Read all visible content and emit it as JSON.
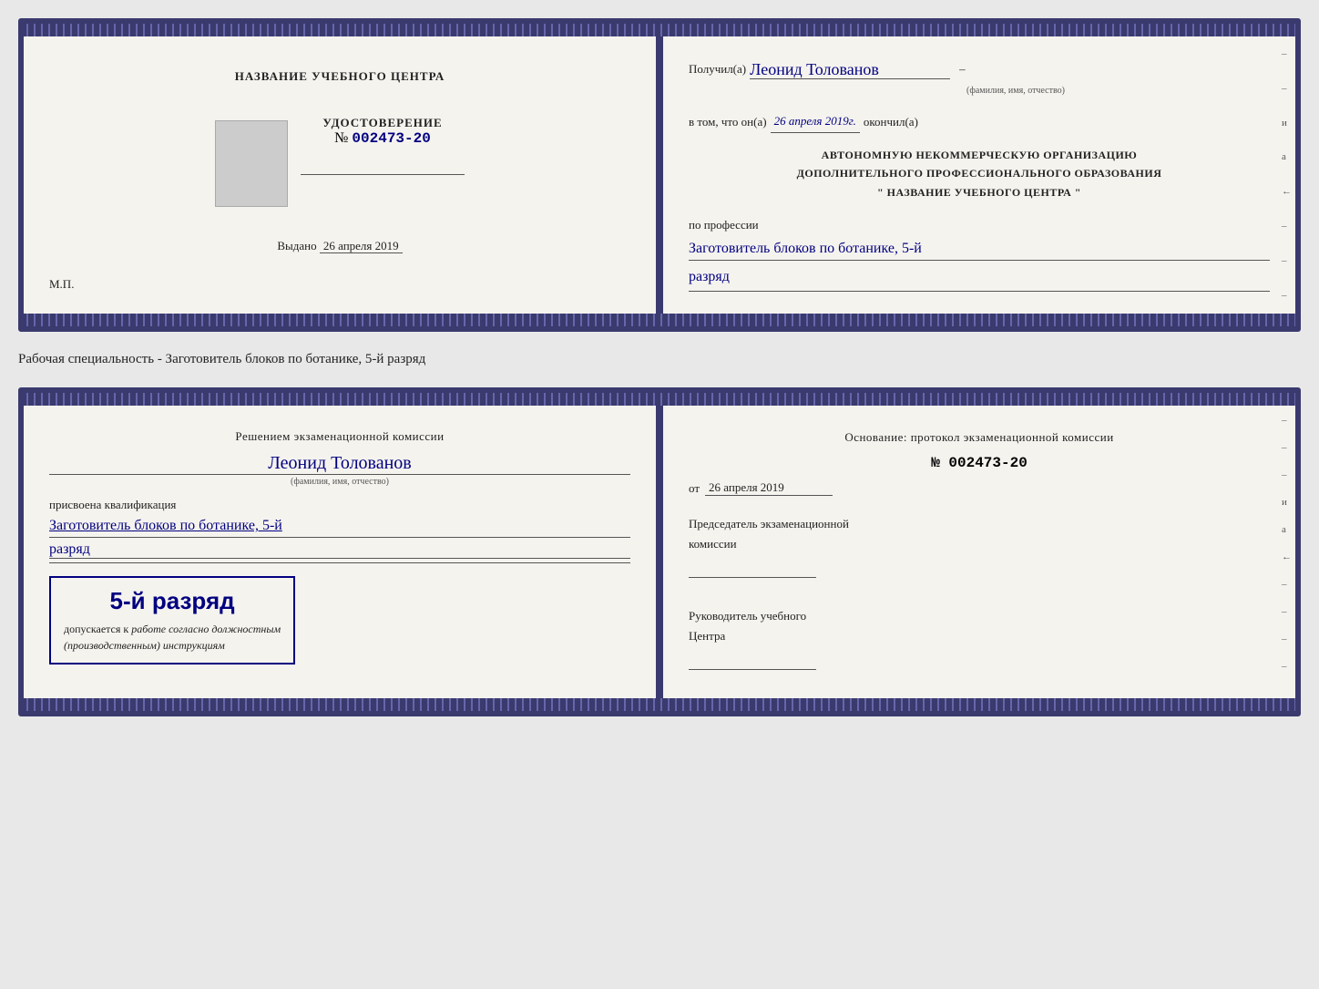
{
  "top_document": {
    "left": {
      "center_title": "НАЗВАНИЕ УЧЕБНОГО ЦЕНТРА",
      "cert_label": "УДОСТОВЕРЕНИЕ",
      "cert_number_prefix": "№",
      "cert_number": "002473-20",
      "issued_label": "Выдано",
      "issued_date": "26 апреля 2019",
      "stamp_label": "М.П."
    },
    "right": {
      "received_label": "Получил(а)",
      "recipient_name": "Леонид Толованов",
      "fio_sublabel": "(фамилия, имя, отчество)",
      "confirmed_label": "в том, что он(а)",
      "confirmed_date": "26 апреля 2019г.",
      "finished_label": "окончил(а)",
      "org_line1": "АВТОНОМНУЮ НЕКОММЕРЧЕСКУЮ ОРГАНИЗАЦИЮ",
      "org_line2": "ДОПОЛНИТЕЛЬНОГО ПРОФЕССИОНАЛЬНОГО ОБРАЗОВАНИЯ",
      "org_line3": "\"   НАЗВАНИЕ УЧЕБНОГО ЦЕНТРА   \"",
      "profession_label": "по профессии",
      "profession_value": "Заготовитель блоков по ботанике, 5-й",
      "razryad_value": "разряд"
    }
  },
  "specialty_text": "Рабочая специальность - Заготовитель блоков по ботанике, 5-й разряд",
  "bottom_document": {
    "left": {
      "commission_text": "Решением экзаменационной комиссии",
      "person_name": "Леонид Толованов",
      "fio_sublabel": "(фамилия, имя, отчество)",
      "assigned_label": "присвоена квалификация",
      "qualification_value": "Заготовитель блоков по ботанике, 5-й",
      "razryad_value": "разряд",
      "stamp_grade": "5-й разряд",
      "stamp_permit": "допускается к",
      "stamp_permit2": "работе согласно должностным",
      "stamp_permit3": "(производственным) инструкциям"
    },
    "right": {
      "basis_label": "Основание: протокол экзаменационной комиссии",
      "protocol_number": "№  002473-20",
      "date_prefix": "от",
      "date_value": "26 апреля 2019",
      "chairman_label": "Председатель экзаменационной",
      "chairman_label2": "комиссии",
      "director_label": "Руководитель учебного",
      "director_label2": "Центра"
    }
  }
}
